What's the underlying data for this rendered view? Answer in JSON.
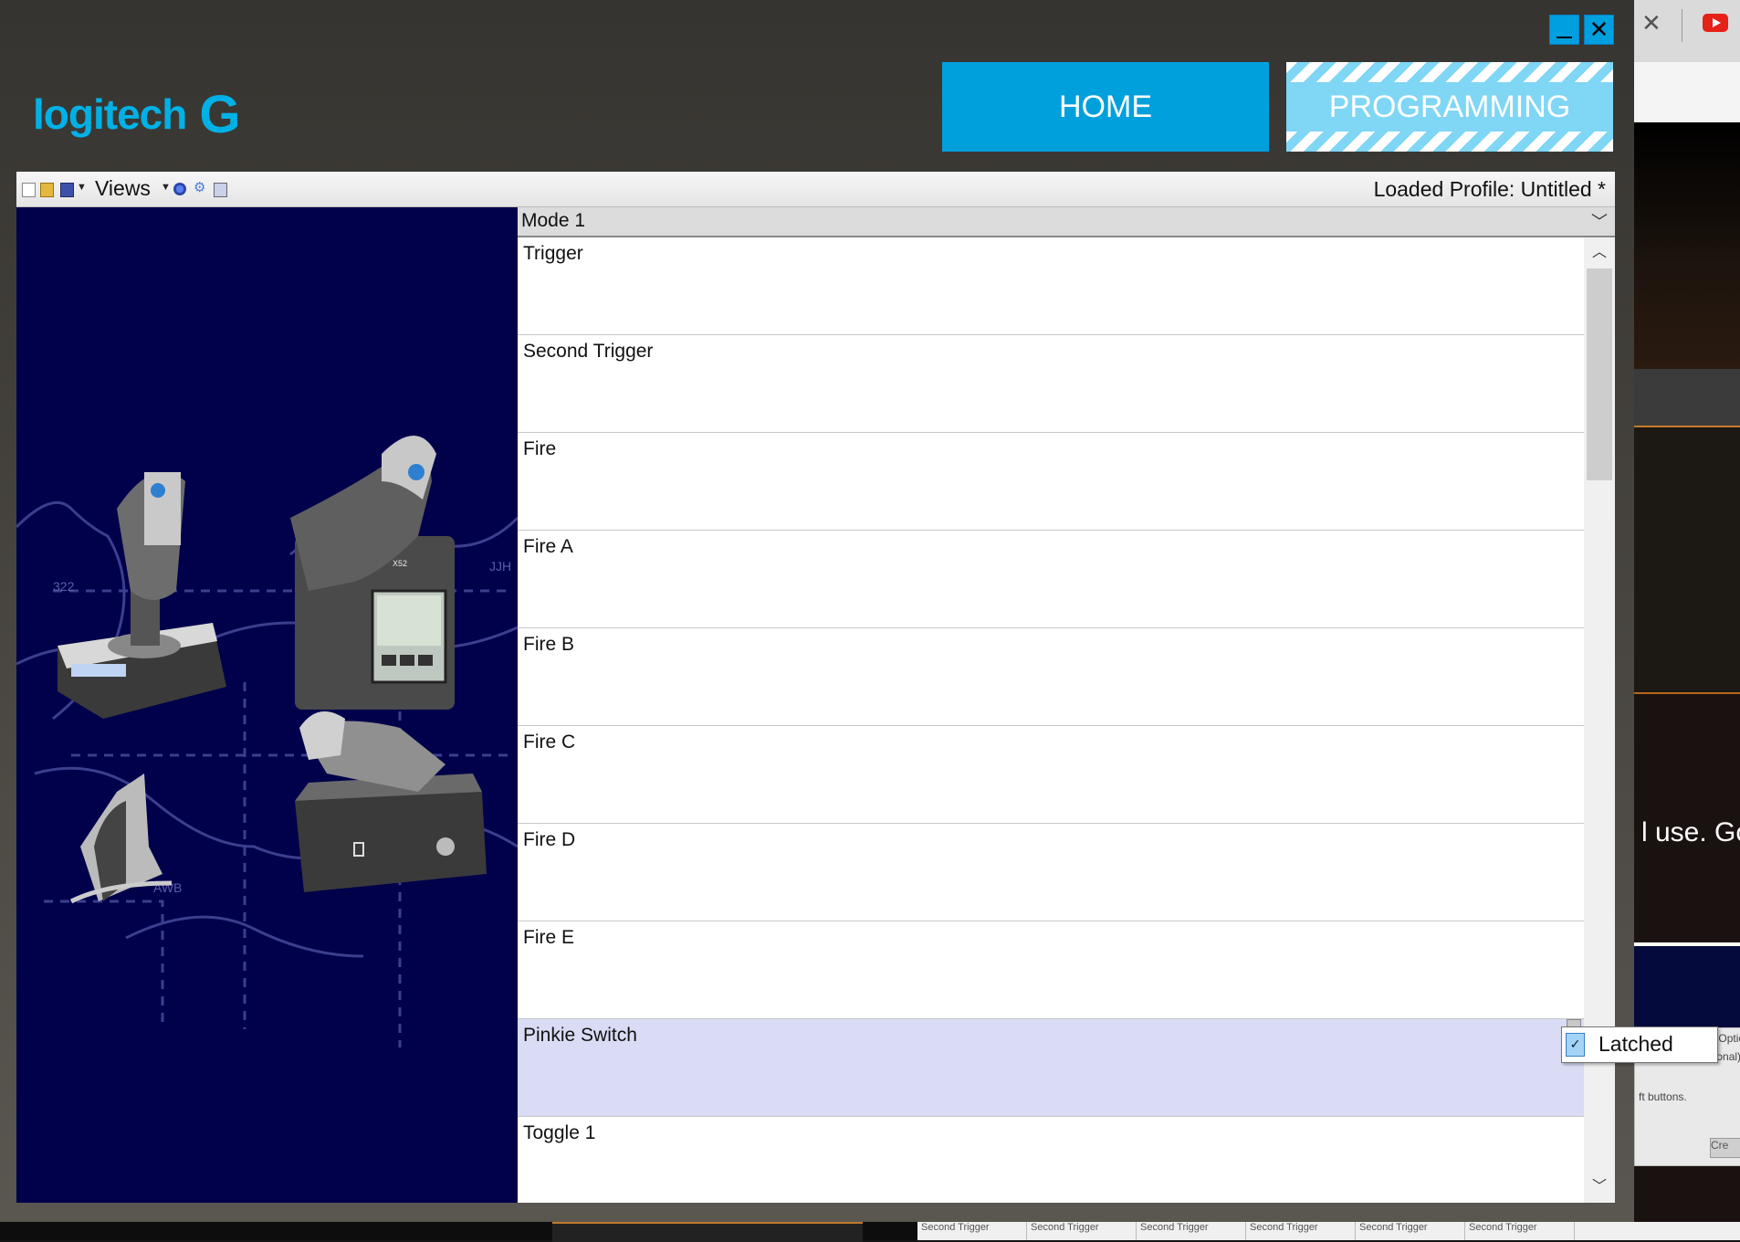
{
  "window": {
    "minimize_label": "_",
    "close_label": "✕"
  },
  "header": {
    "logo_text": "logitech",
    "logo_mark": "G",
    "tabs": [
      {
        "label": "HOME",
        "active": false
      },
      {
        "label": "PROGRAMMING",
        "active": true
      }
    ]
  },
  "toolbar": {
    "views_label": "Views",
    "loaded_profile": "Loaded Profile: Untitled *",
    "icons": [
      "new-profile-icon",
      "open-profile-icon",
      "save-profile-icon",
      "views-dropdown-icon",
      "blue-gem-icon",
      "settings-gear-icon",
      "print-icon"
    ]
  },
  "mode": {
    "selected": "Mode 1"
  },
  "buttons": [
    {
      "label": "Trigger",
      "selected": false
    },
    {
      "label": "Second Trigger",
      "selected": false
    },
    {
      "label": "Fire",
      "selected": false
    },
    {
      "label": "Fire A",
      "selected": false
    },
    {
      "label": "Fire B",
      "selected": false
    },
    {
      "label": "Fire C",
      "selected": false
    },
    {
      "label": "Fire D",
      "selected": false
    },
    {
      "label": "Fire E",
      "selected": false
    },
    {
      "label": "Pinkie Switch",
      "selected": true
    },
    {
      "label": "Toggle 1",
      "selected": false
    }
  ],
  "popup": {
    "latched_label": "Latched",
    "latched_checked": true
  },
  "background_window": {
    "caption_fragment": "l use. Go",
    "lines": [
      "back shiftstate. (Optic",
      "command. (Optional)",
      "ft buttons."
    ],
    "button_fragment": "Cre",
    "strip_cells": [
      "Second Trigger",
      "Second Trigger",
      "Second Trigger",
      "Second Trigger",
      "Second Trigger",
      "Second Trigger"
    ]
  },
  "device_map": {
    "labels": [
      "322",
      "JJH",
      "AWB"
    ],
    "model_label": "X52"
  },
  "colors": {
    "accent": "#00a0dc",
    "accent_light": "#7fd6f5",
    "panel_bg": "#00004b",
    "selected_row": "#dadcf5"
  }
}
